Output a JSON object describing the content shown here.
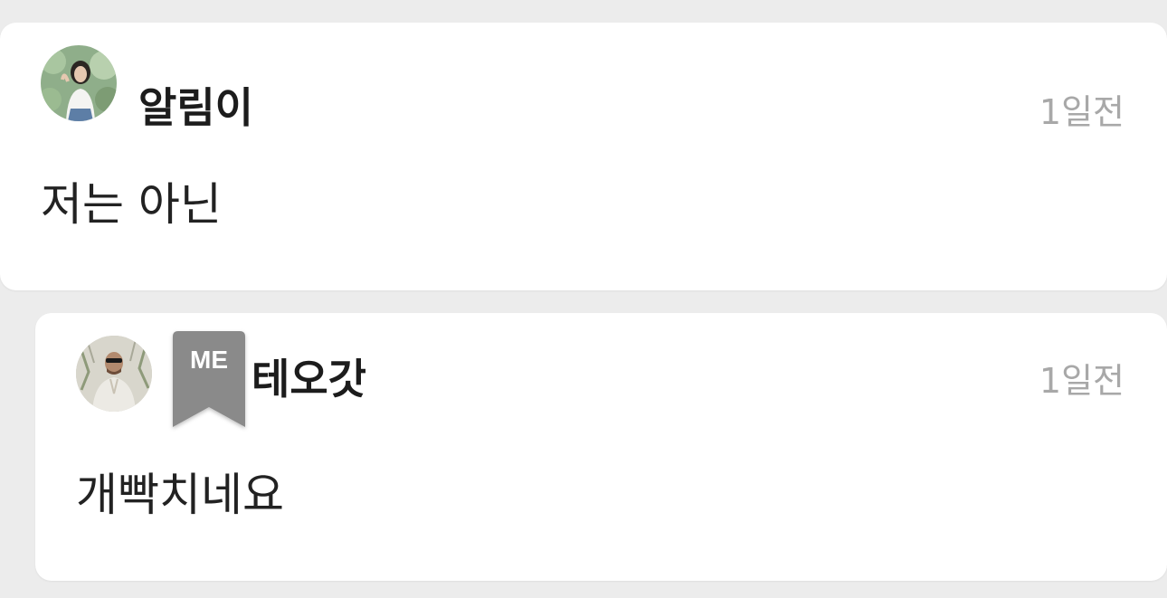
{
  "comment": {
    "username": "알림이",
    "time": "1일전",
    "text": "저는 아닌"
  },
  "reply": {
    "badge": "ME",
    "username": "테오갓",
    "time": "1일전",
    "text": "개빡치네요"
  },
  "colors": {
    "background": "#ececec",
    "card": "#ffffff",
    "username": "#1c1c1c",
    "timestamp": "#a8a8a8",
    "badge": "#8a8a8a"
  },
  "icons": {
    "comment_avatar": "user-avatar-photo",
    "reply_avatar": "user-avatar-photo",
    "badge": "bookmark-ribbon-icon"
  }
}
